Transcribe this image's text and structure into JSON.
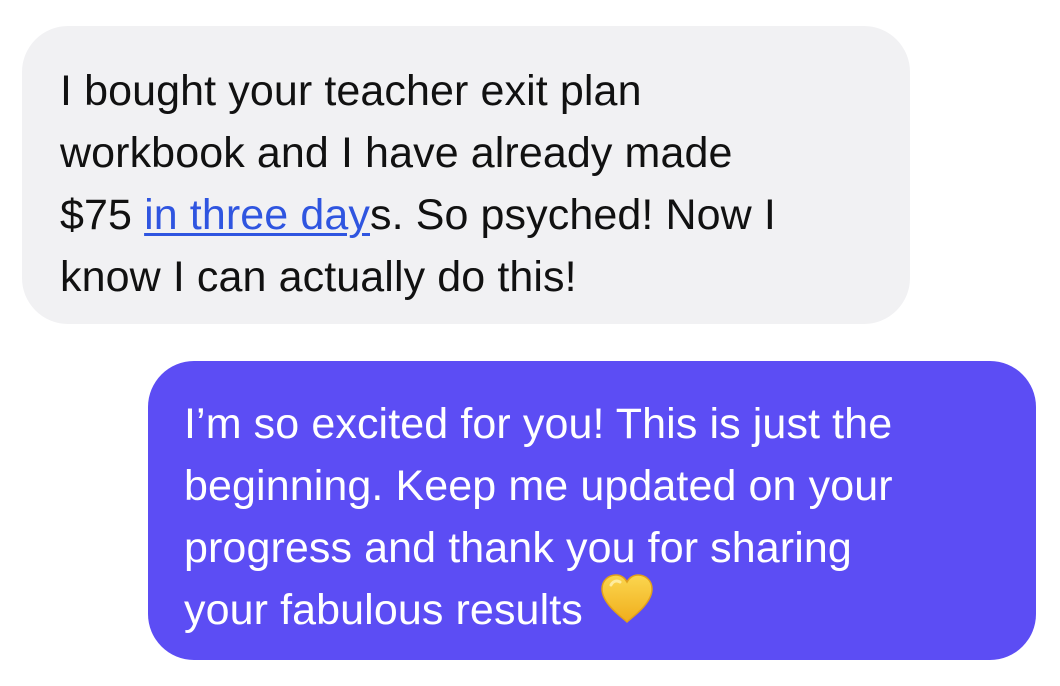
{
  "conversation": {
    "incoming_message": {
      "line1": "I bought your teacher exit plan",
      "line2": "workbook and I have already made",
      "line3_before_link": "$75 ",
      "line3_link": "in three day",
      "line3_after_link": "s. So psyched! Now I",
      "line4": "know I can actually do this!"
    },
    "outgoing_message": {
      "line1": "I’m so excited for you! This is just the",
      "line2": "beginning. Keep me updated on your",
      "line3": "progress and thank you for sharing",
      "line4": "your fabulous results",
      "emoji": "yellow-heart-icon"
    },
    "colors": {
      "incoming_bubble": "#f1f1f3",
      "outgoing_bubble": "#5c4df4",
      "link": "#2f55e0",
      "heart": "#f6c334"
    }
  }
}
